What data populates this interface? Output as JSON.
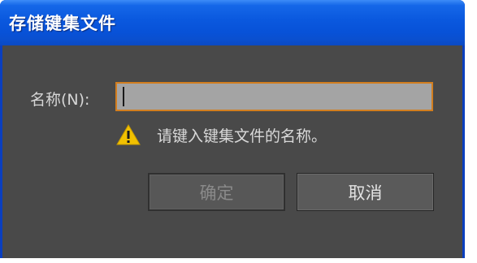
{
  "window": {
    "title": "存储键集文件"
  },
  "form": {
    "name_label": "名称(N):",
    "name_value": "",
    "warning_text": "请键入键集文件的名称。",
    "warning_icon": "warning-icon"
  },
  "buttons": {
    "ok_label": "确定",
    "cancel_label": "取消"
  },
  "colors": {
    "titlebar": "#0a58de",
    "body": "#494949",
    "input_border": "#d27e1f",
    "warning": "#f2c100"
  }
}
